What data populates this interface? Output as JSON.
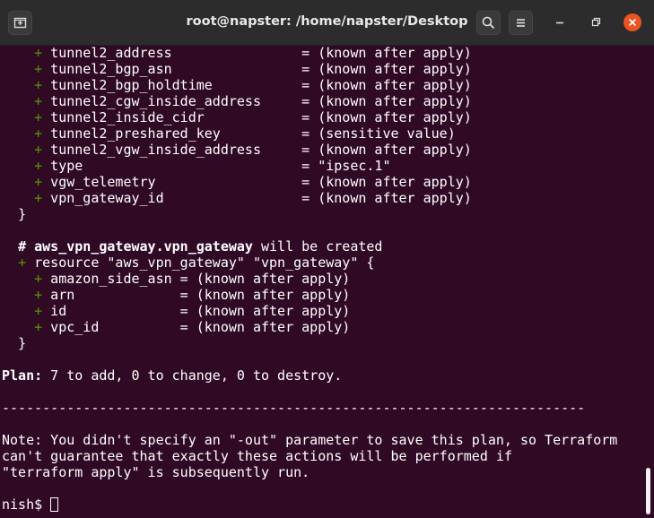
{
  "window": {
    "title": "root@napster: /home/napster/Desktop"
  },
  "terminal": {
    "lines": [
      {
        "indent": "    ",
        "plus": "+",
        "text": " tunnel2_address                = (known after apply)"
      },
      {
        "indent": "    ",
        "plus": "+",
        "text": " tunnel2_bgp_asn                = (known after apply)"
      },
      {
        "indent": "    ",
        "plus": "+",
        "text": " tunnel2_bgp_holdtime           = (known after apply)"
      },
      {
        "indent": "    ",
        "plus": "+",
        "text": " tunnel2_cgw_inside_address     = (known after apply)"
      },
      {
        "indent": "    ",
        "plus": "+",
        "text": " tunnel2_inside_cidr            = (known after apply)"
      },
      {
        "indent": "    ",
        "plus": "+",
        "text": " tunnel2_preshared_key          = (sensitive value)"
      },
      {
        "indent": "    ",
        "plus": "+",
        "text": " tunnel2_vgw_inside_address     = (known after apply)"
      },
      {
        "indent": "    ",
        "plus": "+",
        "text": " type                           = \"ipsec.1\""
      },
      {
        "indent": "    ",
        "plus": "+",
        "text": " vgw_telemetry                  = (known after apply)"
      },
      {
        "indent": "    ",
        "plus": "+",
        "text": " vpn_gateway_id                 = (known after apply)"
      },
      {
        "indent": "  ",
        "plus": "",
        "text": "}"
      },
      {
        "indent": "",
        "plus": "",
        "text": ""
      },
      {
        "indent": "  ",
        "plus": "",
        "bold": "# aws_vpn_gateway.vpn_gateway",
        "text": " will be created"
      },
      {
        "indent": "  ",
        "plus": "+",
        "text": " resource \"aws_vpn_gateway\" \"vpn_gateway\" {"
      },
      {
        "indent": "    ",
        "plus": "+",
        "text": " amazon_side_asn = (known after apply)"
      },
      {
        "indent": "    ",
        "plus": "+",
        "text": " arn             = (known after apply)"
      },
      {
        "indent": "    ",
        "plus": "+",
        "text": " id              = (known after apply)"
      },
      {
        "indent": "    ",
        "plus": "+",
        "text": " vpc_id          = (known after apply)"
      },
      {
        "indent": "  ",
        "plus": "",
        "text": "}"
      },
      {
        "indent": "",
        "plus": "",
        "text": ""
      },
      {
        "indent": "",
        "plus": "",
        "bold": "Plan:",
        "text": " 7 to add, 0 to change, 0 to destroy."
      },
      {
        "indent": "",
        "plus": "",
        "text": ""
      },
      {
        "indent": "",
        "plus": "",
        "text": "------------------------------------------------------------------------"
      },
      {
        "indent": "",
        "plus": "",
        "text": ""
      },
      {
        "indent": "",
        "plus": "",
        "text": "Note: You didn't specify an \"-out\" parameter to save this plan, so Terraform"
      },
      {
        "indent": "",
        "plus": "",
        "text": "can't guarantee that exactly these actions will be performed if"
      },
      {
        "indent": "",
        "plus": "",
        "text": "\"terraform apply\" is subsequently run."
      },
      {
        "indent": "",
        "plus": "",
        "text": ""
      }
    ],
    "prompt": "nish$ "
  },
  "colors": {
    "background": "#300a24",
    "plus": "#4e9a06",
    "close": "#e95420"
  }
}
